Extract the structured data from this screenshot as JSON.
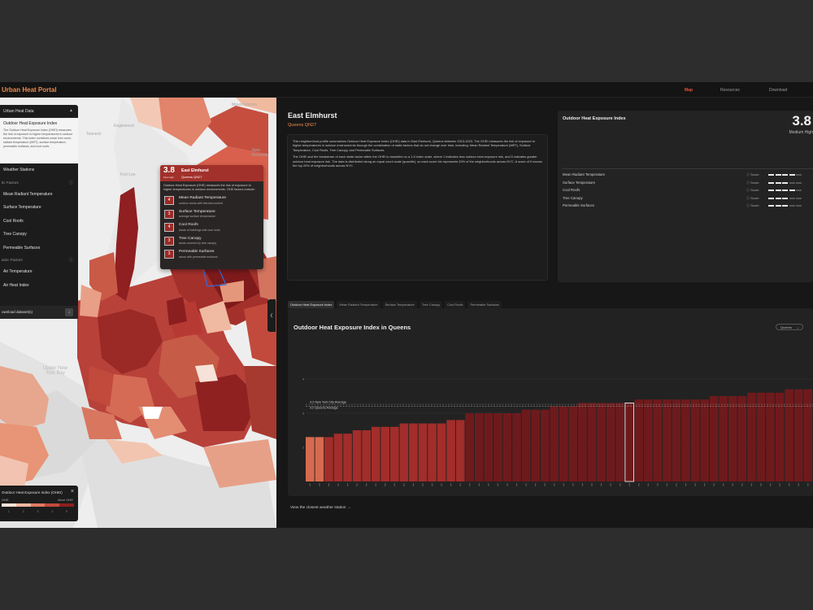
{
  "app": {
    "brand": "Urban Heat Portal",
    "nav": [
      {
        "label": "Map",
        "active": true
      },
      {
        "label": "Resources",
        "active": false
      },
      {
        "label": "Download",
        "active": false
      }
    ]
  },
  "sidebar": {
    "header": "Urban Heat Data",
    "active_item": {
      "title": "Outdoor Heat Exposure Index",
      "description": "The Outdoor Heat Exposure Index (OHEI) measures the risk of exposure to higher temperatures in outdoor environments. This index combines mean tree cover, radiant temperature (MRT), surface temperature, permeable surfaces, and cool roofs."
    },
    "weather_stations": "Weather Stations",
    "static_group": "tic Factors",
    "static_items": [
      "Mean Radiant Temperature",
      "Surface Temperature",
      "Cool Roofs",
      "Tree Canopy",
      "Permeable Surfaces"
    ],
    "dynamic_group": "amic Factors",
    "dynamic_items": [
      "Air Temperature",
      "Air Heat Index"
    ],
    "download": "ownload dataset(s)"
  },
  "map_labels": {
    "mount_vernon": "Mount Vernon",
    "englewood": "Englewood",
    "teaneck": "Teaneck",
    "fort_lee": "Fort Lee",
    "new_rochelle": "New Rochelle",
    "upper_new_york_bay": "Upper New York Bay"
  },
  "tooltip": {
    "score": "3.8",
    "level": "Med High",
    "name": "East Elmhurst",
    "code": "Queens QN27",
    "description": "Outdoor Heat Exposure (OHE) measures the risk of exposure to higher temperatures in outdoor environments. OHE factors include:",
    "factors": [
      {
        "score": "4",
        "title": "Mean Radiant Temperature",
        "sub": "outdoor areas with thermal comfort"
      },
      {
        "score": "3",
        "title": "Surface Temperature",
        "sub": "average surface temperature"
      },
      {
        "score": "4",
        "title": "Cool Roofs",
        "sub": "areas of buildings with cool roofs"
      },
      {
        "score": "3",
        "title": "Tree Canopy",
        "sub": "areas covered by tree canopy"
      },
      {
        "score": "3",
        "title": "Permeable Surfaces",
        "sub": "areas with permeable surfaces"
      }
    ]
  },
  "legend": {
    "title": "Outdoor Heat Exposure Index (OHEI)",
    "low": "OHE",
    "high": "More OHE",
    "classes": [
      "1",
      "2",
      "3",
      "4",
      "5"
    ],
    "colors": [
      "#f5e3d8",
      "#f0b7a0",
      "#e07a62",
      "#c24a3c",
      "#8f1f20"
    ]
  },
  "profile": {
    "name": "East Elmhurst",
    "code": "Queens QN27",
    "paragraphs": [
      "This neighborhood profile summarizes Outdoor Heat Exposure Index (OHEI) data in East Elmhurst, Queens between 2013-2023. The OHEI measures the risk of exposure to higher temperatures in outdoor environments through the combination of static factors that do not change over time, including: Mean Radiant Temperature (MRT), Surface Temperature, Cool Roofs, Tree Canopy, and Permeable Surfaces.",
      "The OHEI and the breakdown of each static factor within the OHEI is classified on a 1-5 index scale, where 1 indicates less outdoor heat exposure risk, and 5 indicates greater outdoor heat exposure risk. The data is distributed along an equal count scale (quantile), so each score bin represents 20% of the neighborhoods across NYC. A score of 5 means the top 20% of neighborhoods across NYC."
    ]
  },
  "ohei_card": {
    "title": "Outdoor Heat Exposure Index",
    "score": "3.8",
    "level": "Medium High",
    "score_label": "Score",
    "factors": [
      {
        "name": "Mean Radiant Temperature",
        "score": 4
      },
      {
        "name": "Surface Temperature",
        "score": 3
      },
      {
        "name": "Cool Roofs",
        "score": 4
      },
      {
        "name": "Tree Canopy",
        "score": 3
      },
      {
        "name": "Permeable Surfaces",
        "score": 3
      }
    ]
  },
  "tabs": [
    "Outdoor Heat Exposure Index",
    "Mean Radiant Temperature",
    "Surface Temperature",
    "Tree Canopy",
    "Cool Roofs",
    "Permeable Surfaces"
  ],
  "chart_select": "Queens",
  "chart_data": {
    "type": "bar",
    "title": "Outdoor Heat Exposure Index in Queens",
    "ylim": [
      1,
      5
    ],
    "y_ticks": [
      2,
      3,
      4
    ],
    "reference_lines": [
      {
        "label": "3.2 New York City Average",
        "value": 3.26
      },
      {
        "label": "3.2 Queens Average",
        "value": 3.2
      }
    ],
    "highlight_index": 34,
    "values": [
      2.3,
      2.3,
      2.3,
      2.4,
      2.4,
      2.5,
      2.5,
      2.6,
      2.6,
      2.6,
      2.7,
      2.7,
      2.7,
      2.7,
      2.7,
      2.8,
      2.8,
      3.0,
      3.0,
      3.0,
      3.0,
      3.0,
      3.0,
      3.1,
      3.1,
      3.1,
      3.2,
      3.2,
      3.2,
      3.3,
      3.3,
      3.3,
      3.3,
      3.3,
      3.3,
      3.4,
      3.4,
      3.4,
      3.4,
      3.4,
      3.4,
      3.4,
      3.4,
      3.5,
      3.5,
      3.5,
      3.5,
      3.6,
      3.6,
      3.6,
      3.6,
      3.7,
      3.7,
      3.7
    ]
  },
  "weather_link": "View the closest weather station"
}
